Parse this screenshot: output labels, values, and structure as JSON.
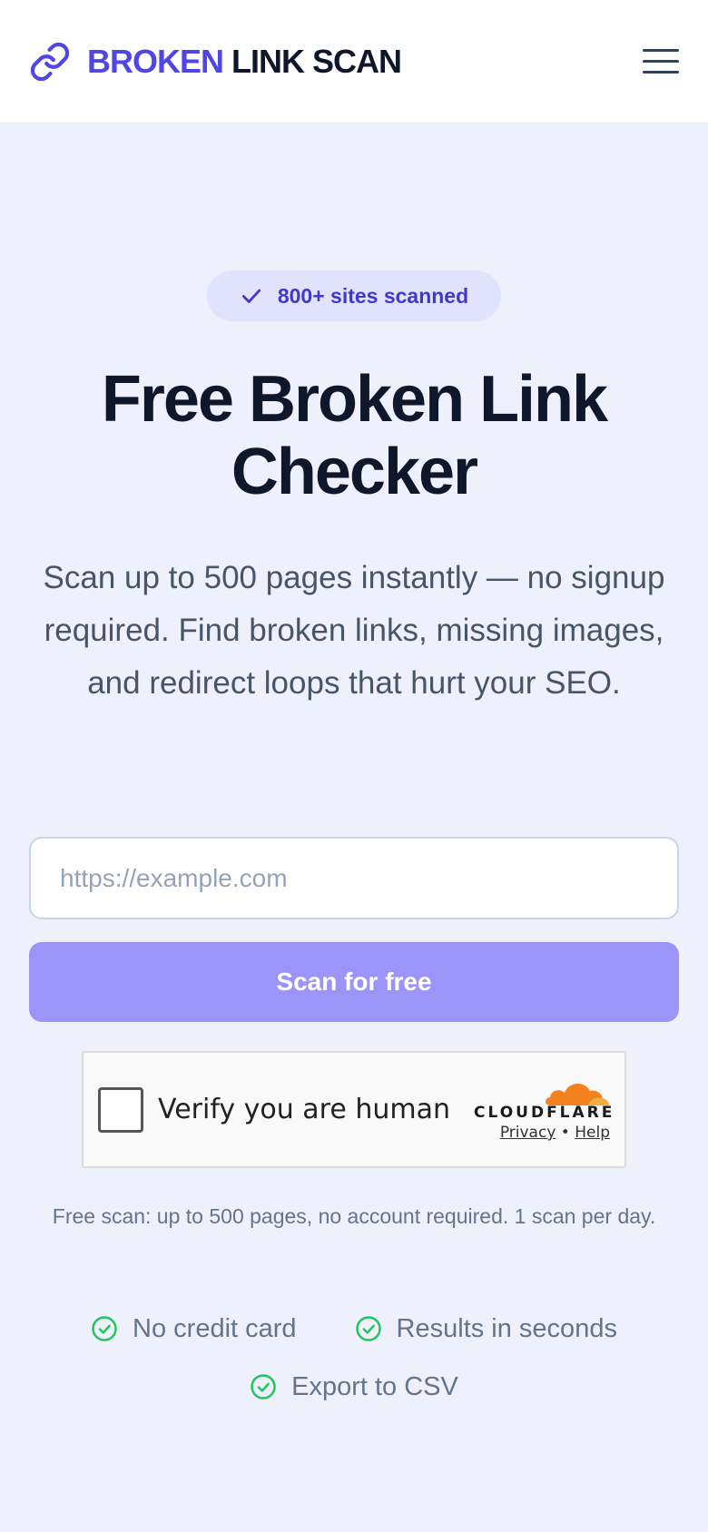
{
  "header": {
    "brand_part1": "BROKEN",
    "brand_part2": "LINK SCAN",
    "logo_icon": "link-icon",
    "menu_icon": "hamburger-menu-icon"
  },
  "hero": {
    "badge_text": "800+ sites scanned",
    "badge_icon": "check-icon",
    "title": "Free Broken Link Checker",
    "subtitle": "Scan up to 500 pages instantly — no signup required. Find broken links, missing images, and redirect loops that hurt your SEO."
  },
  "form": {
    "url_placeholder": "https://example.com",
    "url_value": "",
    "scan_button_label": "Scan for free"
  },
  "captcha": {
    "label": "Verify you are human",
    "provider": "CLOUDFLARE",
    "privacy_link": "Privacy",
    "separator": "•",
    "help_link": "Help"
  },
  "note": "Free scan: up to 500 pages, no account required. 1 scan per day.",
  "features": [
    {
      "label": "No credit card",
      "icon": "check-circle-icon"
    },
    {
      "label": "Results in seconds",
      "icon": "check-circle-icon"
    },
    {
      "label": "Export to CSV",
      "icon": "check-circle-icon"
    }
  ],
  "colors": {
    "brand": "#4f46e5",
    "background": "#eef1fb",
    "button": "#9b94f9",
    "success": "#22c55e",
    "cloudflare": "#f48120"
  }
}
